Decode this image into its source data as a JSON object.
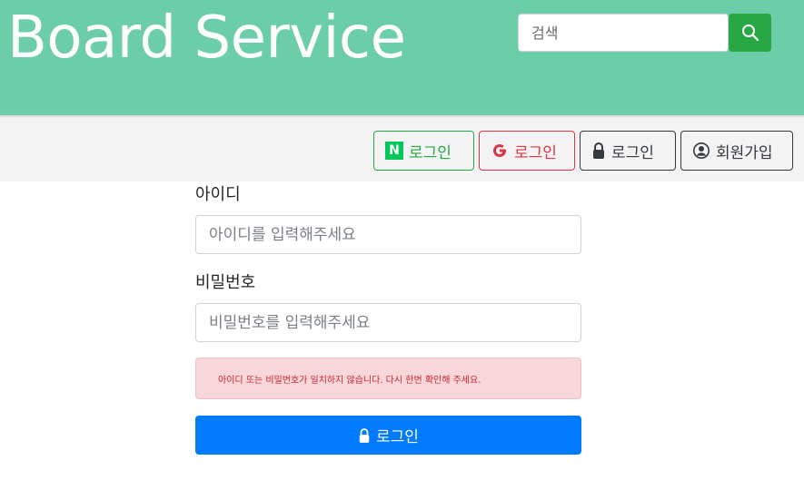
{
  "header": {
    "brand": "Board Service",
    "search_placeholder": "검색",
    "accent_color": "#6bcea9"
  },
  "nav": {
    "naver_mark": "N",
    "naver_login": "로그인",
    "google_login": "로그인",
    "login": "로그인",
    "signup": "회원가입"
  },
  "form": {
    "id_label": "아이디",
    "id_placeholder": "아이디를 입력해주세요",
    "pw_label": "비밀번호",
    "pw_placeholder": "비밀번호를 입력해주세요",
    "error_message": "아이디 또는 비밀번호가 일치하지 않습니다. 다시 한번 확인해 주세요.",
    "submit_label": "로그인"
  },
  "icons": {
    "search": "search-icon",
    "naver": "naver-icon",
    "google": "google-icon",
    "lock": "lock-icon",
    "user": "user-circle-icon"
  }
}
